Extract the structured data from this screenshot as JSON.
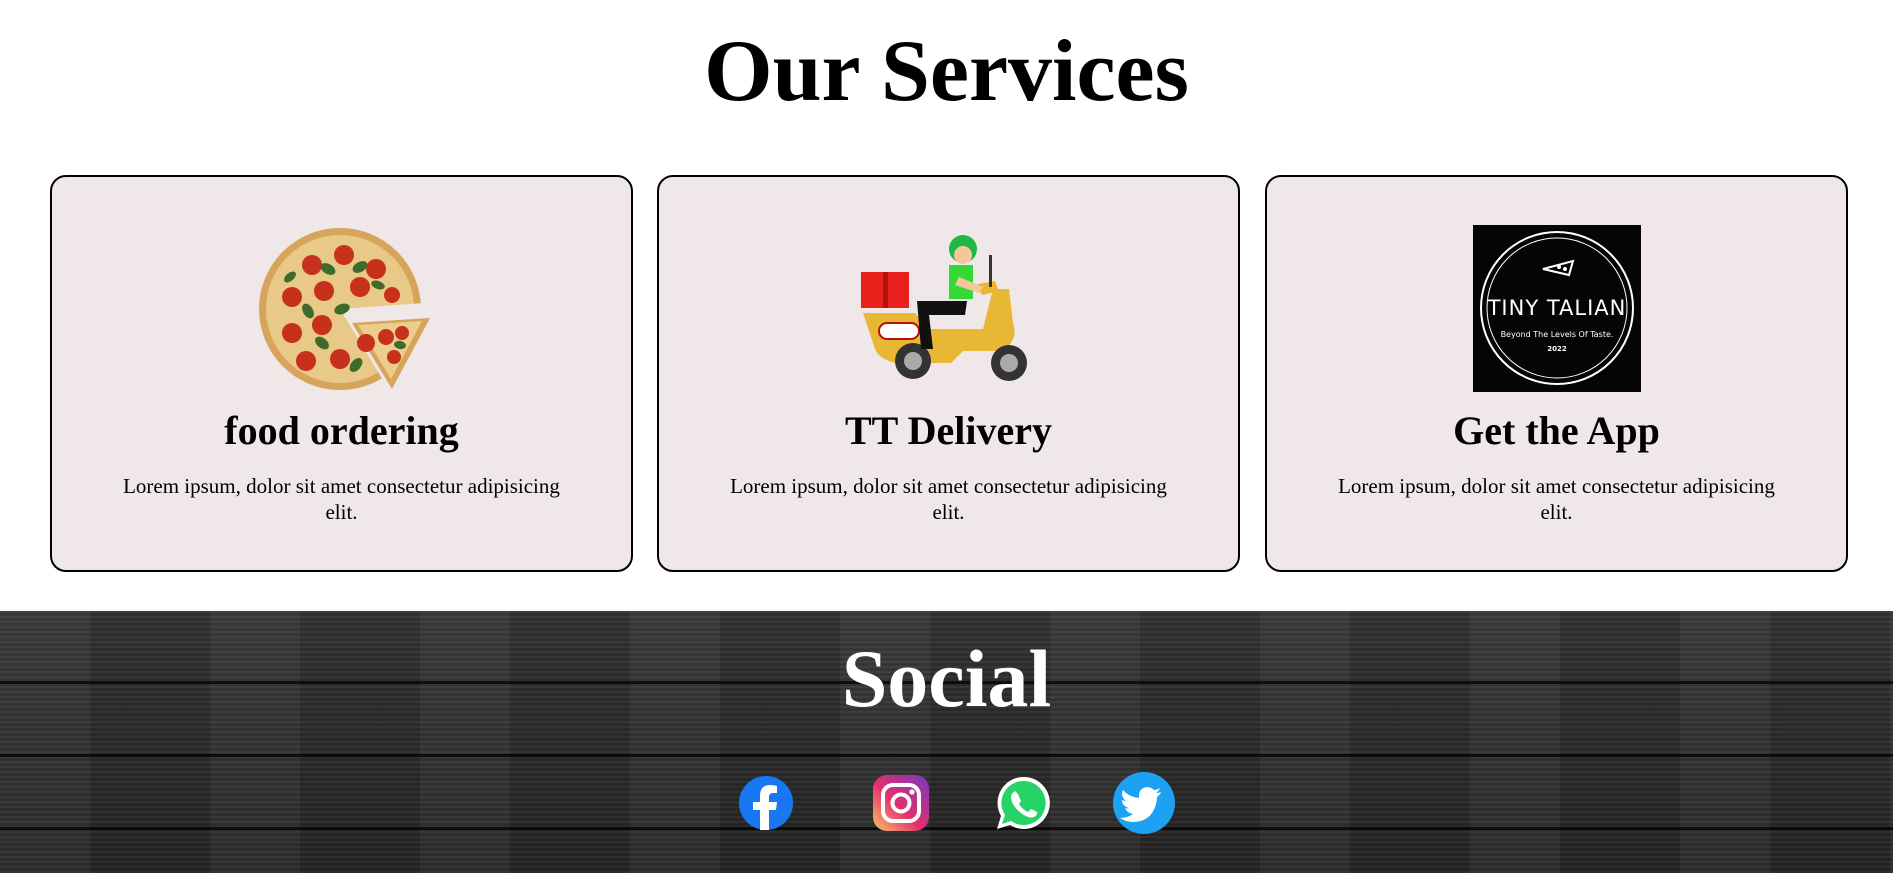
{
  "services": {
    "title": "Our Services",
    "cards": [
      {
        "title": "food ordering",
        "text": "Lorem ipsum, dolor sit amet consectetur adipisicing elit.",
        "icon": "pizza-image"
      },
      {
        "title": "TT Delivery",
        "text": "Lorem ipsum, dolor sit amet consectetur adipisicing elit.",
        "icon": "delivery-scooter-image"
      },
      {
        "title": "Get the App",
        "text": "Lorem ipsum, dolor sit amet consectetur adipisicing elit.",
        "icon": "tiny-talian-logo"
      }
    ]
  },
  "logo": {
    "brand": "TINY TALIAN",
    "tagline": "Beyond The Levels Of Taste.",
    "year": "2022"
  },
  "social": {
    "title": "Social",
    "links": [
      {
        "icon": "facebook-icon",
        "color": "#1877f2"
      },
      {
        "icon": "instagram-icon",
        "color": "#d62976"
      },
      {
        "icon": "whatsapp-icon",
        "color": "#25d366"
      },
      {
        "icon": "twitter-icon",
        "color": "#1da1f2"
      }
    ]
  }
}
